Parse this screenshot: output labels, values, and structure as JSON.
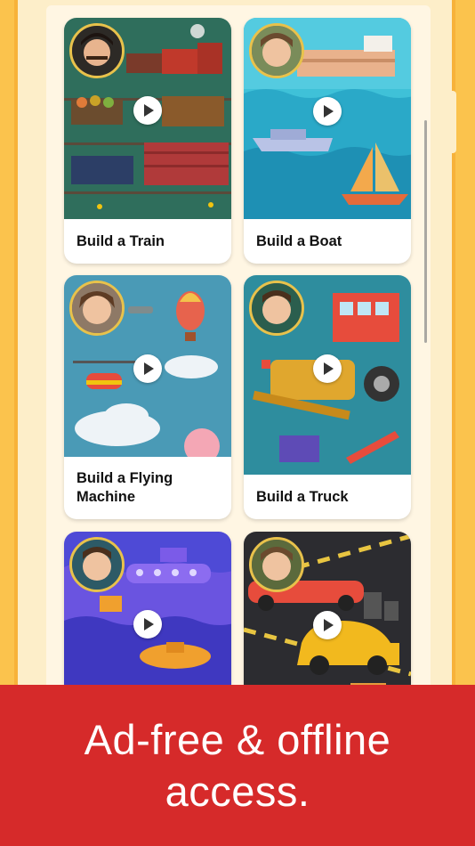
{
  "videos": [
    {
      "title": "Build a Train"
    },
    {
      "title": "Build a Boat"
    },
    {
      "title": "Build a Flying Machine"
    },
    {
      "title": "Build a Truck"
    },
    {
      "title": ""
    },
    {
      "title": ""
    }
  ],
  "banner": {
    "line1": "Ad-free & offline",
    "line2": "access."
  },
  "icons": {
    "play": "play-icon"
  },
  "colors": {
    "background": "#FBC34D",
    "banner": "#D62A2A",
    "avatar_ring": "#E8C24B"
  }
}
